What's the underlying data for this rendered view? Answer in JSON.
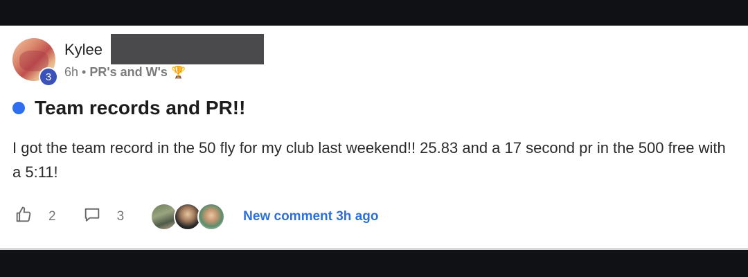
{
  "post": {
    "author": "Kylee",
    "level": "3",
    "time": "6h",
    "separator": "•",
    "group": "PR's and W's",
    "group_icon": "trophy-icon",
    "title": "Team records and PR!!",
    "body": "I got the team record in the 50 fly for my club last weekend!! 25.83 and a 17 second pr in the 500 free with a 5:11!"
  },
  "actions": {
    "like_count": "2",
    "comment_count": "3",
    "new_comment": "New comment 3h ago"
  },
  "colors": {
    "accent": "#2f6fd6",
    "unread_dot": "#2f6ef0",
    "level_badge": "#3b53b8"
  }
}
